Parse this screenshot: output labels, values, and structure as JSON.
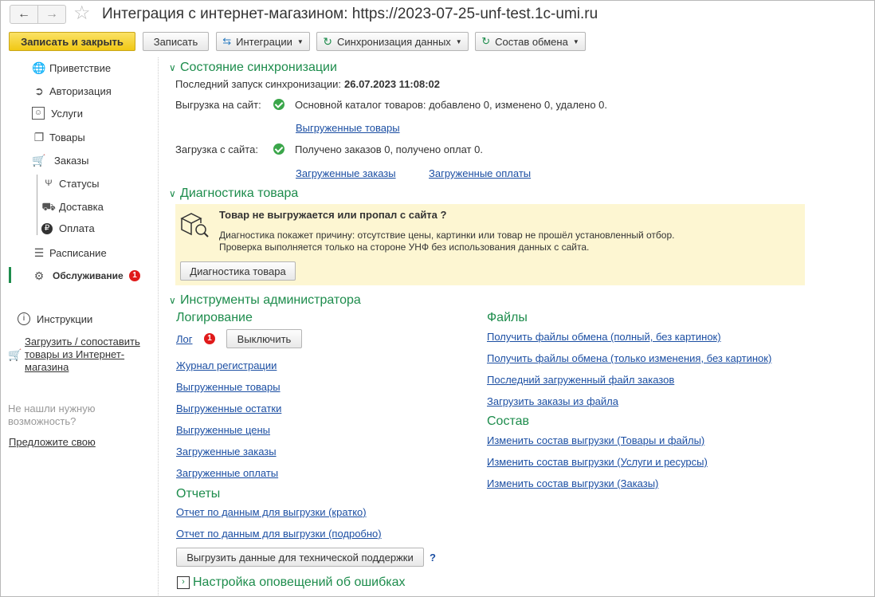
{
  "window": {
    "title": "Интеграция с интернет-магазином: https://2023-07-25-unf-test.1c-umi.ru"
  },
  "toolbar": {
    "save_close": "Записать и закрыть",
    "save": "Записать",
    "integrations": "Интеграции",
    "sync_data": "Синхронизация данных",
    "exchange_content": "Состав обмена"
  },
  "sidebar": {
    "items": [
      {
        "label": "Приветствие",
        "icon": "globe-icon"
      },
      {
        "label": "Авторизация",
        "icon": "login-icon"
      },
      {
        "label": "Услуги",
        "icon": "services-icon"
      },
      {
        "label": "Товары",
        "icon": "box-icon"
      },
      {
        "label": "Заказы",
        "icon": "basket-icon"
      },
      {
        "label": "Статусы",
        "icon": "status-icon"
      },
      {
        "label": "Доставка",
        "icon": "truck-icon"
      },
      {
        "label": "Оплата",
        "icon": "ruble-icon"
      },
      {
        "label": "Расписание",
        "icon": "schedule-icon"
      },
      {
        "label": "Обслуживание",
        "icon": "gear-icon",
        "badge": "1"
      }
    ],
    "instructions": "Инструкции",
    "load_match": "Загрузить / сопоставить товары из Интернет-магазина",
    "not_found": "Не нашли нужную возможность?",
    "suggest": "Предложите свою"
  },
  "sync": {
    "title": "Состояние синхронизации",
    "last_run_label": "Последний запуск синхронизации:",
    "last_run_value": "26.07.2023 11:08:02",
    "upload_label": "Выгрузка на сайт:",
    "upload_status": "Основной каталог товаров: добавлено 0, изменено 0, удалено 0.",
    "upload_link": "Выгруженные товары",
    "download_label": "Загрузка с сайта:",
    "download_status": "Получено заказов 0, получено оплат 0.",
    "orders_link": "Загруженные заказы",
    "payments_link": "Загруженные оплаты"
  },
  "diagnostics": {
    "title": "Диагностика товара",
    "question": "Товар не выгружается или пропал с сайта ?",
    "text1": "Диагностика покажет причину: отсутствие цены, картинки или товар не прошёл установленный отбор.",
    "text2": "Проверка выполняется только на стороне УНФ без использования данных с сайта.",
    "button": "Диагностика товара"
  },
  "admin": {
    "title": "Инструменты администратора",
    "logging_title": "Логирование",
    "log_link": "Лог",
    "log_badge": "1",
    "disable_button": "Выключить",
    "links": [
      "Журнал регистрации",
      "Выгруженные товары",
      "Выгруженные остатки",
      "Выгруженные цены",
      "Загруженные заказы",
      "Загруженные оплаты"
    ],
    "reports_title": "Отчеты",
    "report_links": [
      "Отчет по данным для выгрузки (кратко)",
      "Отчет по данным для выгрузки (подробно)"
    ],
    "support_button": "Выгрузить данные для технической поддержки",
    "help": "?",
    "files_title": "Файлы",
    "file_links": [
      "Получить файлы обмена (полный, без картинок)",
      "Получить файлы обмена (только изменения, без картинок)",
      "Последний загруженный файл заказов",
      "Загрузить заказы из файла"
    ],
    "composition_title": "Состав",
    "composition_links": [
      "Изменить состав выгрузки (Товары и файлы)",
      "Изменить состав выгрузки (Услуги и ресурсы)",
      "Изменить состав выгрузки (Заказы)"
    ]
  },
  "notifications": {
    "title": "Настройка оповещений об ошибках"
  },
  "colors": {
    "accent_yellow": "#f5d33a",
    "section_green": "#1d8c4c",
    "link_blue": "#1c4fa3",
    "diag_bg": "#fdf6d2",
    "badge_red": "#e01b1b"
  }
}
